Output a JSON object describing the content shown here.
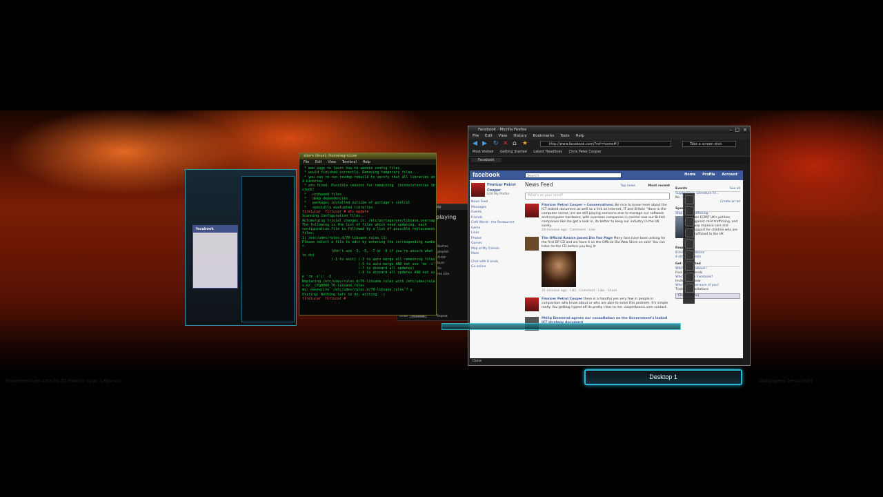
{
  "terminal": {
    "title": "xterm (linux): /home/wgrn/cow",
    "menu": [
      "File",
      "Edit",
      "View",
      "Terminal",
      "Help"
    ],
    "lines": [
      " * man page to learn how to update config files.",
      " * would finished correctly. Removing temporary files...",
      " * you can re-run revdep-rebuild to verify that all libraries an",
      "d binaries",
      " * are fixed. Possible reasons for remaining  inconsistencies in",
      "clude:",
      " *   orphaned files",
      " *   deep dependencies",
      " *   packages installed outside of portage's control",
      " *   specially evaluated libraries",
      "firelucar  firlucar # etc-update",
      "Scanning Configuration files...",
      "Automerging trivial changes in: /etc/portage/env/libsane.overnap",
      "The following is the list of files which need updating, each",
      "configuration file is followed by a list of possible replacement",
      "files.",
      "1) /etc/udev/rules.d/70-libsane.rules (1)",
      "Please select a file to edit by entering the corresponding numbe",
      "r.",
      "              (don't use -3, -5, -7 or -9 if you're unsure what",
      "to do)",
      "              (-1 to exit) (-3 to auto merge all remaining files)",
      "                           (-5 to auto-merge AND not use 'mv -i')",
      "                           (-7 to discard all updates)",
      "                           (-9 to discard all updates AND not us",
      "e 'rm -i'): -3",
      "Replacing /etc/udev/rules.d/70-libsane.rules with /etc/udev/rule",
      "s.d/._cfg0000_70-libsane.rules",
      "mv: overwrite '/etc/udev/rules.d/70-libsane.rules'? y",
      "Exiting: Nothing left to do; exiting. :)",
      "firelucar  firlucar #"
    ]
  },
  "midpanel": {
    "menu": [
      "Help"
    ],
    "text_playing": "playing",
    "rows": [
      "lbertas",
      "playlist",
      "Artist",
      "bum",
      "ite",
      "me title"
    ],
    "order_label": "Order",
    "order_value": "In Circel",
    "repeat": "Repeat"
  },
  "firefox": {
    "title": "Facebook - Mozilla Firefox",
    "menu": [
      "File",
      "Edit",
      "View",
      "History",
      "Bookmarks",
      "Tools",
      "Help"
    ],
    "url": "http://www.facebook.com/?ref=home#!/",
    "search": "Take a screen shot",
    "bookmarks": [
      "Most Visited",
      "Getting Started",
      "Latest Headlines",
      "Chris Peter Cooper"
    ],
    "tab": "Facebook",
    "status": "Done"
  },
  "facebook": {
    "logo": "facebook",
    "search_placeholder": "Search",
    "toplinks": [
      "Home",
      "Profile",
      "Account"
    ],
    "profile_name": "Finnicer Petrol Cooper",
    "edit_profile": "Edit My Profile",
    "left_nav": [
      "News Feed",
      "Messages",
      "Events",
      "Friends",
      "Café World - the Restaurant Game",
      "Links",
      "Photos",
      "Games",
      "Map of My Friends",
      "More"
    ],
    "chat": "Chat with Friends",
    "go_online": "Go online",
    "news_feed_title": "News Feed",
    "top_news": "Top news",
    "most_recent": "Most recent",
    "status_placeholder": "What's on your mind?",
    "stories": [
      {
        "author": "Finnicer Petrol Cooper » Conservatives:",
        "text": "Be nice to know more about the ICT leaked document as well as a link on Internet, IT and Britain \"Have in the computer sector, are we still playing someone else to manage our software and computer hardware, with overseas companies in control now our British companies like me get a look in, its better to keep our industry in the UK surely.",
        "meta": "28 minutes ago · Comment · Like"
      },
      {
        "author": "The Official Ronnie James Dio Fan Page",
        "text": "Many fans have been asking for the first EP CD and we have it on the Official Dio Web Store on sale! You can listen to the CD before you buy it:",
        "meta": "31 minutes ago · 182 · Comment · Like · Share"
      },
      {
        "author": "Finnicer Petrol Cooper",
        "text": "there is a handful yes very few in people in comparison who know about or who are able to solve this problem. It's simple really. You getting ripped off its pretty clear to me. cooperbronic.com contact",
        "meta": ""
      },
      {
        "author": "Philip Emmerod agrees our consultation on the Government's leaked ICT strategy document",
        "text": "",
        "meta": ""
      }
    ],
    "right_events_hdr": "Events",
    "see_all": "See all",
    "right_items": [
      "Suggestions: Literature Fe...",
      "No · Maybe",
      "Create an ad",
      "Sponsored",
      "Stop Child Trafficking",
      "Join ECPAT UK's petition against child trafficking, and help improve care and support for children who are trafficked to the UK",
      "Requests",
      "8 event invitations",
      "4 other requests",
      "Get connected",
      "Who's on Facebook?",
      "Find more friends",
      "Who's not on Facebook?",
      "Invite them now",
      "Who's here because of you?",
      "Track your invitations"
    ],
    "chat_offline": "Chat (Offline)"
  },
  "desktop_label": "Desktop 1",
  "reflection": [
    "Pandemonium Attacks ID Hamza Ilyas, Lebanon",
    "Wallpapers Deviantart"
  ]
}
